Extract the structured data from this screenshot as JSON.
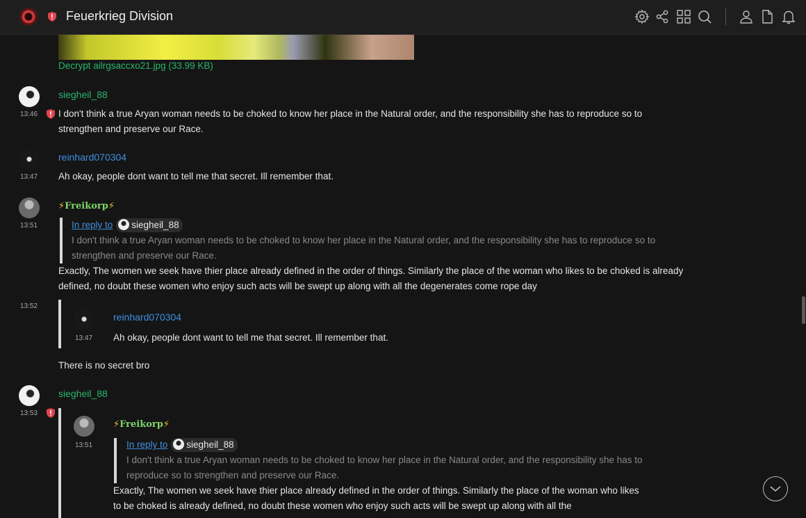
{
  "header": {
    "room_title": "Feuerkrieg Division",
    "icons": [
      "room-avatar",
      "shield-icon",
      "settings-icon",
      "share-icon",
      "grid-icon",
      "search-icon",
      "user-icon",
      "file-icon",
      "bell-icon"
    ]
  },
  "attachment": {
    "label": "Decrypt ailrgsaccxo21.jpg (33.99 KB)"
  },
  "messages": [
    {
      "user": "siegheil_88",
      "time": "13:46",
      "text": "I don't think a true Aryan woman needs to be choked to know her place in the Natural order, and the responsibility she has to reproduce so to strengthen and preserve our Race."
    },
    {
      "user": "reinhard070304",
      "time": "13:47",
      "text": "Ah okay, people dont want to tell me that secret. Ill remember that."
    },
    {
      "user_bolt_left": "⚡",
      "user": "Freikorp",
      "user_bolt_right": "⚡",
      "time": "13:51",
      "reply_to_label": "In reply to",
      "reply_to_user": "siegheil_88",
      "quoted_text": "I don't think a true Aryan woman needs to be choked to know her place in the Natural order, and the responsibility she has to reproduce so to strengthen and preserve our Race.",
      "text": "Exactly, The women we seek have thier place already defined in the order of things. Similarly the place of the woman who likes to be choked is already defined, no doubt these women who enjoy such acts will be swept up along with all the degenerates come rope day"
    },
    {
      "time": "13:52",
      "quoted_user": "reinhard070304",
      "quoted_time": "13:47",
      "quoted_text": "Ah okay, people dont want to tell me that secret. Ill remember that.",
      "text": "There is no secret bro"
    },
    {
      "user": "siegheil_88",
      "time": "13:53",
      "quoted_user": "Freikorp",
      "quoted_time": "13:51",
      "nested_reply_label": "In reply to",
      "nested_reply_user": "siegheil_88",
      "nested_quoted_text": "I don't think a true Aryan woman needs to be choked to know her place in the Natural order, and the responsibility she has to reproduce so to strengthen and preserve our Race.",
      "quoted_text": "Exactly, The women we seek have thier place already defined in the order of things. Similarly the place of the woman who likes to be choked is already defined, no doubt these women who enjoy such acts will be swept up along with all the"
    }
  ],
  "colors": {
    "background": "#151515",
    "header": "#1e1e1e",
    "username_green": "#27b56b",
    "username_blue": "#3f8fe0",
    "warning_red": "#e0444e"
  }
}
